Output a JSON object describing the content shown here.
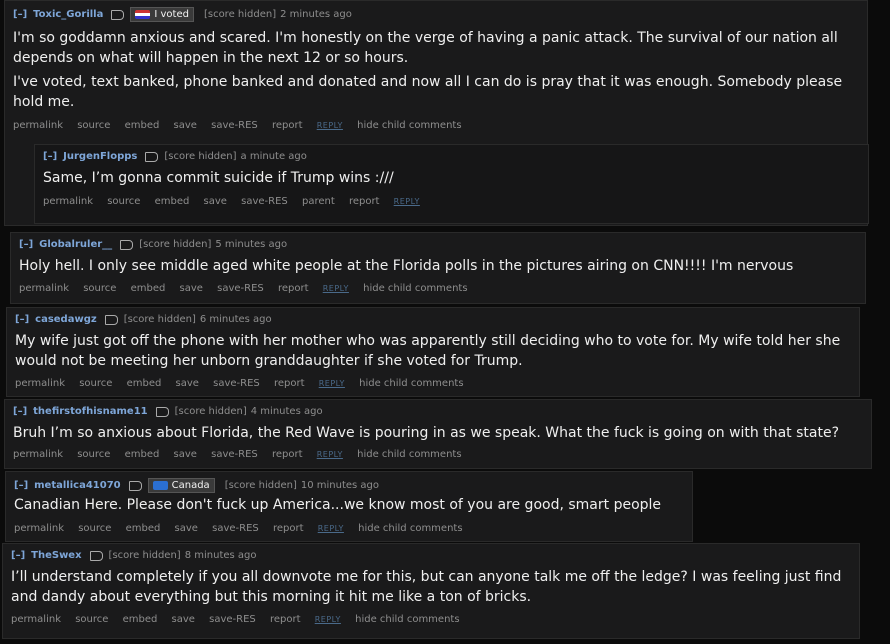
{
  "comments": [
    {
      "author": "Toxic_Gorilla",
      "flair": "I voted",
      "score": "[score hidden]",
      "time": "2 minutes ago",
      "paragraphs": [
        "I'm so goddamn anxious and scared. I'm honestly on the verge of having a panic attack. The survival of our nation all depends on what will happen in the next 12 or so hours.",
        "I've voted, text banked, phone banked and donated and now all I can do is pray that it was enough. Somebody please hold me."
      ],
      "actions": [
        "permalink",
        "source",
        "embed",
        "save",
        "save-RES",
        "report"
      ],
      "reply": "REPLY",
      "hide": "hide child comments"
    },
    {
      "author": "JurgenFlopps",
      "score": "[score hidden]",
      "time": "a minute ago",
      "paragraphs": [
        "Same, I’m gonna commit suicide if Trump wins :///"
      ],
      "actions": [
        "permalink",
        "source",
        "embed",
        "save",
        "save-RES",
        "parent",
        "report"
      ],
      "reply": "REPLY"
    },
    {
      "author": "Globalruler__",
      "score": "[score hidden]",
      "time": "5 minutes ago",
      "paragraphs": [
        "Holy hell. I only see middle aged white people at the Florida polls in the pictures airing on CNN!!!! I'm nervous"
      ],
      "actions": [
        "permalink",
        "source",
        "embed",
        "save",
        "save-RES",
        "report"
      ],
      "reply": "REPLY",
      "hide": "hide child comments"
    },
    {
      "author": "casedawgz",
      "score": "[score hidden]",
      "time": "6 minutes ago",
      "paragraphs": [
        "My wife just got off the phone with her mother who was apparently still deciding who to vote for. My wife told her she would not be meeting her unborn granddaughter if she voted for Trump."
      ],
      "actions": [
        "permalink",
        "source",
        "embed",
        "save",
        "save-RES",
        "report"
      ],
      "reply": "REPLY",
      "hide": "hide child comments"
    },
    {
      "author": "thefirstofhisname11",
      "score": "[score hidden]",
      "time": "4 minutes ago",
      "paragraphs": [
        "Bruh I’m so anxious about Florida, the Red Wave is pouring in as we speak. What the fuck is going on with that state?"
      ],
      "actions": [
        "permalink",
        "source",
        "embed",
        "save",
        "save-RES",
        "report"
      ],
      "reply": "REPLY",
      "hide": "hide child comments"
    },
    {
      "author": "metallica41070",
      "flair": "Canada",
      "score": "[score hidden]",
      "time": "10 minutes ago",
      "paragraphs": [
        "Canadian Here. Please don't fuck up America...we know most of you are good, smart people"
      ],
      "actions": [
        "permalink",
        "source",
        "embed",
        "save",
        "save-RES",
        "report"
      ],
      "reply": "REPLY",
      "hide": "hide child comments"
    },
    {
      "author": "TheSwex",
      "score": "[score hidden]",
      "time": "8 minutes ago",
      "paragraphs": [
        "I’ll understand completely if you all downvote me for this, but can anyone talk me off the ledge? I was feeling just find and dandy about everything but this morning it hit me like a ton of bricks."
      ],
      "actions": [
        "permalink",
        "source",
        "embed",
        "save",
        "save-RES",
        "report"
      ],
      "reply": "REPLY",
      "hide": "hide child comments"
    }
  ],
  "toggle_label": "[–]"
}
